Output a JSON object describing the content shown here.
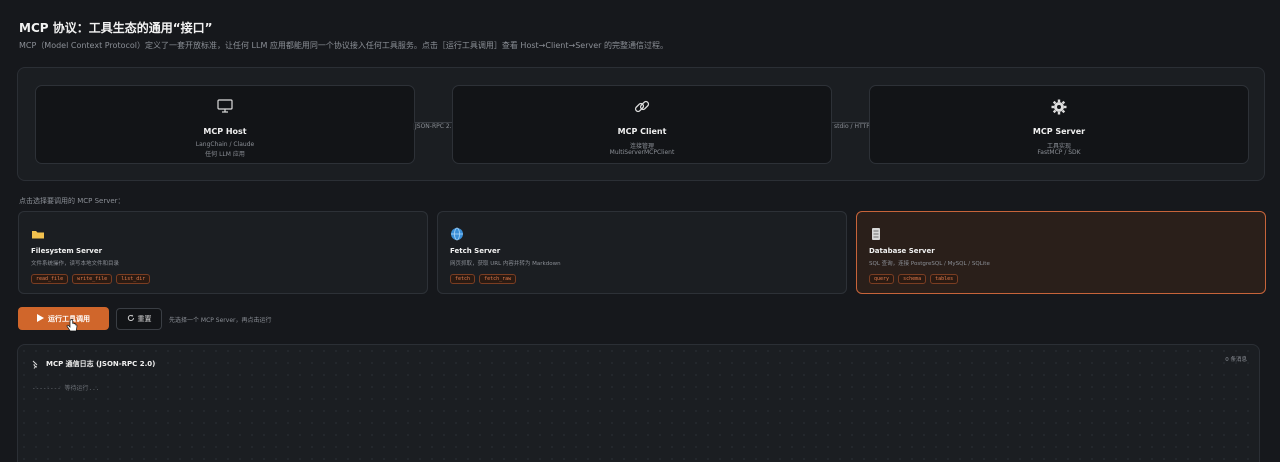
{
  "header": {
    "title": "MCP 协议：工具生态的通用“接口”",
    "subtitle": "MCP（Model Context Protocol）定义了一套开放标准，让任何 LLM 应用都能用同一个协议接入任何工具服务。点击［运行工具调用］查看 Host→Client→Server 的完整通信过程。"
  },
  "architecture": {
    "host": {
      "icon": "monitor-icon",
      "name": "MCP Host",
      "line1": "LangChain / Claude",
      "line2": "任何 LLM 应用"
    },
    "link1": "JSON-RPC 2.0",
    "client": {
      "icon": "link-icon",
      "name": "MCP Client",
      "line1": "连接管理",
      "line2": "MultiServerMCPClient"
    },
    "link2": "stdio / HTTP",
    "server": {
      "icon": "gear-icon",
      "name": "MCP Server",
      "line1": "工具实现",
      "line2": "FastMCP / SDK"
    }
  },
  "picker": {
    "label": "点击选择要调用的 MCP Server：",
    "servers": [
      {
        "icon": "folder-icon",
        "name": "Filesystem Server",
        "desc": "文件系统操作，读写本地文件和目录",
        "tags": [
          "read_file",
          "write_file",
          "list_dir"
        ]
      },
      {
        "icon": "globe-icon",
        "name": "Fetch Server",
        "desc": "网页抓取，获取 URL 内容并转为 Markdown",
        "tags": [
          "fetch",
          "fetch_raw"
        ]
      },
      {
        "icon": "database-icon",
        "name": "Database Server",
        "desc": "SQL 查询，连接 PostgreSQL / MySQL / SQLite",
        "tags": [
          "query",
          "schema",
          "tables"
        ]
      }
    ]
  },
  "controls": {
    "run_label": "运行工具调用",
    "reset_label": "重置",
    "hint": "先选择一个 MCP Server，再点击运行"
  },
  "log": {
    "title": "MCP 通信日志 (JSON-RPC 2.0)",
    "count": "0 条消息",
    "empty": "-------- 等待运行..."
  },
  "colors": {
    "accent": "#d0662b",
    "background": "#16181c",
    "panel": "#1b1e22"
  }
}
